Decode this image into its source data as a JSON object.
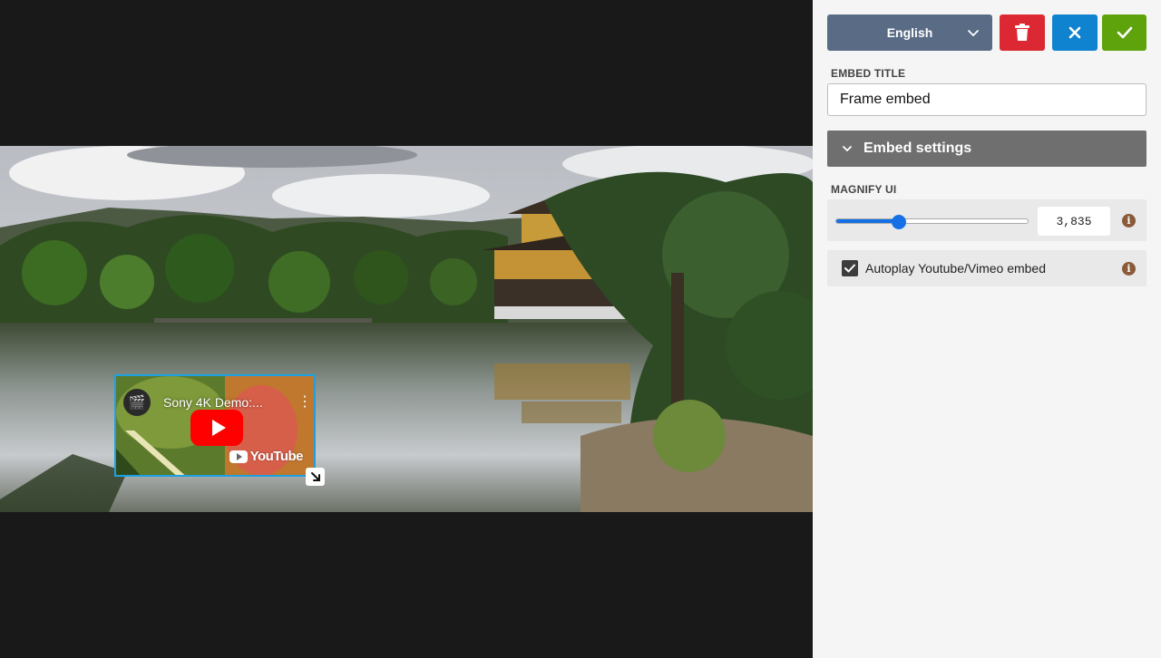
{
  "embed": {
    "video_title": "Sony 4K Demo:...",
    "brand": "YouTube",
    "kebab": "⋮"
  },
  "toolbar": {
    "language": "English",
    "delete_icon": "trash-icon",
    "close_icon": "close-icon",
    "confirm_icon": "check-icon"
  },
  "form": {
    "title_label": "EMBED TITLE",
    "title_value": "Frame embed",
    "settings_heading": "Embed settings",
    "magnify_label": "MAGNIFY UI",
    "magnify_value": "3,835",
    "magnify_fraction": 0.33,
    "autoplay_label": "Autoplay Youtube/Vimeo embed",
    "autoplay_checked": true,
    "info_glyph": "i"
  },
  "colors": {
    "accent": "#1570e6",
    "delete": "#dc2832",
    "close": "#0f83d0",
    "confirm": "#5ea20c",
    "language": "#5a6b85",
    "info": "#8a5a3a"
  }
}
